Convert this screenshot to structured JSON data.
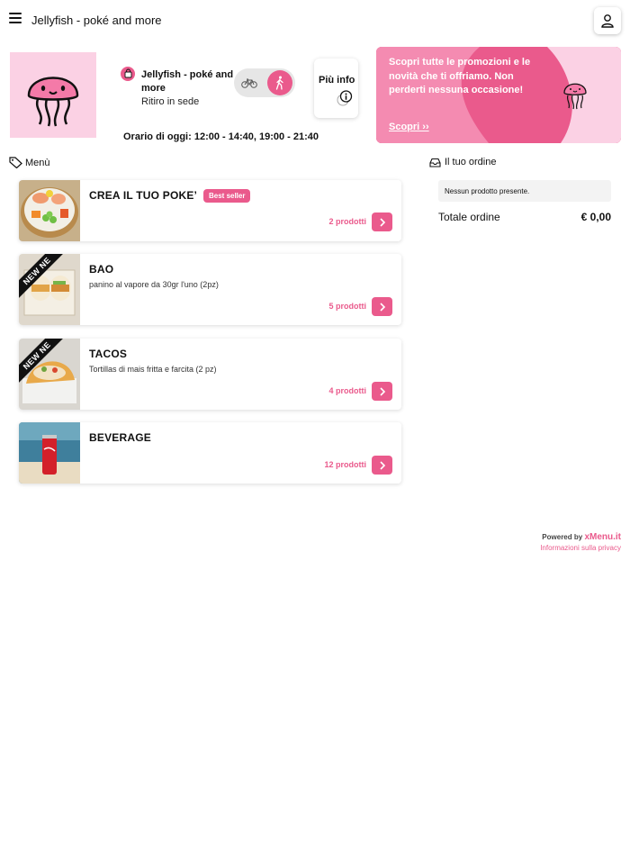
{
  "header": {
    "title": "Jellyfish - poké and more",
    "menu_icon": "hamburger-icon",
    "user_icon": "user-icon"
  },
  "restaurant": {
    "name": "Jellyfish - poké and more",
    "mode": "Ritiro in sede",
    "info_label": "Più info",
    "hours": "Orario di oggi: 12:00 - 14:40, 19:00 - 21:40",
    "selected_mode_icon": "walk-icon",
    "other_mode_icon": "bike-icon"
  },
  "promo": {
    "text": "Scopri tutte le promozioni e le novità che ti offriamo. Non perderti nessuna occasione!",
    "link": "Scopri ››"
  },
  "menu": {
    "heading": "Menù",
    "items": [
      {
        "title": "CREA IL TUO POKE’",
        "badge": "Best seller",
        "description": "",
        "count": "2 prodotti"
      },
      {
        "title": "BAO",
        "ribbon": "NEW NE",
        "description": "panino al vapore da 30gr l'uno (2pz)",
        "count": "5 prodotti"
      },
      {
        "title": "TACOS",
        "ribbon": "NEW NE",
        "description": "Tortillas di mais fritta e farcita (2 pz)",
        "count": "4 prodotti"
      },
      {
        "title": "BEVERAGE",
        "description": "",
        "count": "12 prodotti"
      }
    ]
  },
  "order": {
    "heading": "Il tuo ordine",
    "empty": "Nessun prodotto presente.",
    "total_label": "Totale ordine",
    "total_value": "€ 0,00"
  },
  "footer": {
    "powered_prefix": "Powered by",
    "powered_brand": "xMenu.it",
    "privacy": "Informazioni sulla privacy"
  },
  "colors": {
    "accent": "#ea5a8c",
    "logo_bg": "#fbd1e4"
  }
}
